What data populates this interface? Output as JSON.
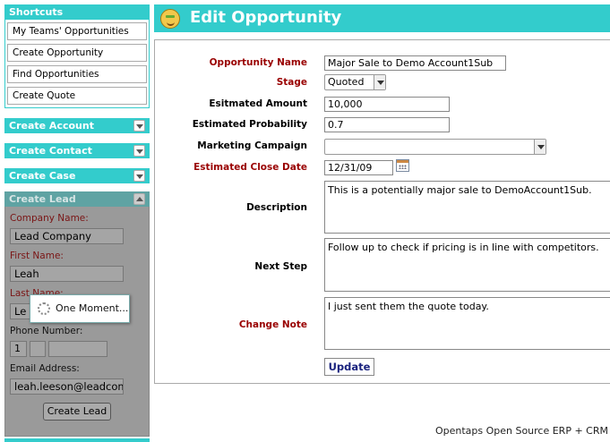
{
  "sidebar": {
    "shortcuts_title": "Shortcuts",
    "shortcuts": [
      "My Teams' Opportunities",
      "Create Opportunity",
      "Find Opportunities",
      "Create Quote"
    ],
    "sections": [
      "Create Account",
      "Create Contact",
      "Create Case"
    ],
    "create_lead": {
      "title": "Create Lead",
      "company_label": "Company Name:",
      "company_value": "Lead Company",
      "first_label": "First Name:",
      "first_value": "Leah",
      "last_label": "Last Name:",
      "last_value": "Le",
      "phone_label": "Phone Number:",
      "phone_country": "1",
      "email_label": "Email Address:",
      "email_value": "leah.leeson@leadcomp",
      "submit_label": "Create Lead",
      "loading_text": "One Moment..."
    }
  },
  "header": {
    "title": "Edit Opportunity"
  },
  "form": {
    "name_label": "Opportunity Name",
    "name_value": "Major Sale to Demo Account1Sub",
    "stage_label": "Stage",
    "stage_value": "Quoted",
    "amount_label": "Esitmated Amount",
    "amount_value": "10,000",
    "probability_label": "Estimated Probability",
    "probability_value": "0.7",
    "campaign_label": "Marketing Campaign",
    "campaign_value": "",
    "close_label": "Estimated Close Date",
    "close_value": "12/31/09",
    "description_label": "Description",
    "description_value": "This is a potentially major sale to DemoAccount1Sub.",
    "nextstep_label": "Next Step",
    "nextstep_value": "Follow up to check if pricing is in line with competitors.",
    "note_label": "Change Note",
    "note_value": "I just sent them the quote today.",
    "update_label": "Update"
  },
  "footer": {
    "text": "Opentaps Open Source ERP + CRM"
  },
  "colors": {
    "accent": "#33cccc",
    "required_label": "#990000",
    "button_text": "#1a237e"
  }
}
